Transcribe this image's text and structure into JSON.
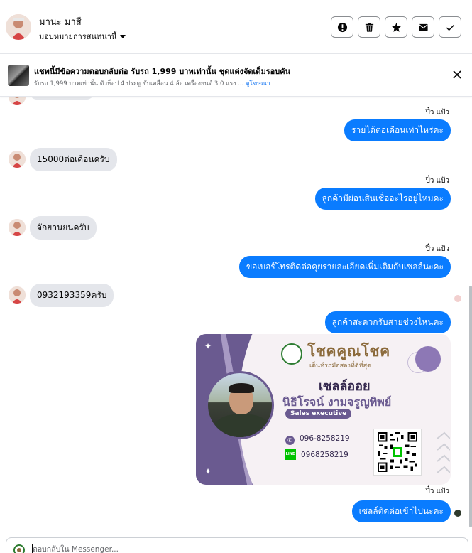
{
  "header": {
    "contact_name": "มานะ มาสี",
    "assign_label": "มอบหมายการสนทนานี้",
    "actions": [
      {
        "name": "mark-spam-button",
        "icon": "exclamation-icon"
      },
      {
        "name": "delete-button",
        "icon": "trash-icon"
      },
      {
        "name": "star-button",
        "icon": "star-icon"
      },
      {
        "name": "mark-unread-button",
        "icon": "envelope-icon"
      },
      {
        "name": "mark-done-button",
        "icon": "check-icon"
      }
    ]
  },
  "ad": {
    "title": "แชทนี้มีข้อความตอบกลับต่อ รับรถ 1,999 บาทเท่านั้น ชุดแต่งจัดเต็มรอบคัน",
    "subtitle": "รับรถ 1,999 บาทเท่านั้น ตัวท็อป 4 ประตู ขับเคลื่อน 4 ล้อ เครื่องยนต์ 3.0 แรง ...",
    "link": "ดูโฆษณา"
  },
  "messages": [
    {
      "type": "out",
      "sender": "ปิ๋ว แป้ว",
      "text": "รายได้ต่อเดือนเท่าไหร่คะ"
    },
    {
      "type": "in",
      "text": "15000ต่อเดือนครับ"
    },
    {
      "type": "out",
      "sender": "ปิ๋ว แป้ว",
      "text": "ลูกค้ามีผ่อนสินเชื่ออะไรอยู่ไหมคะ"
    },
    {
      "type": "in",
      "text": "จักยานยนครับ"
    },
    {
      "type": "out",
      "sender": "ปิ๋ว แป้ว",
      "text": "ขอเบอร์โทรติดต่อคุยรายละเอียดเพิ่มเติมกับเซลล์นะคะ"
    },
    {
      "type": "in",
      "text": "0932193359ครับ"
    },
    {
      "type": "out",
      "text": "ลูกค้าสะดวกรับสายช่วงไหนคะ"
    },
    {
      "type": "out",
      "sender": "ปิ๋ว แป้ว",
      "text": "เซลล์ติดต่อเข้าไปนะคะ"
    }
  ],
  "business_card": {
    "brand": "โชคคูณโชค",
    "brand_tagline": "เต็นท์รถมือสองที่ดีที่สุด",
    "nickname": "เซลล์ออย",
    "full_name": "นิธิโรจน์  งามจรูญทิพย์",
    "role": "Sales executive",
    "phone": "096-8258219",
    "line_label": "LINE",
    "line_id": "0968258219"
  },
  "composer": {
    "placeholder": "ตอบกลับใน Messenger..."
  },
  "colors": {
    "outgoing_bubble": "#0a7cff",
    "incoming_bubble": "#e4e6eb",
    "card_purple": "#6a5a90"
  }
}
